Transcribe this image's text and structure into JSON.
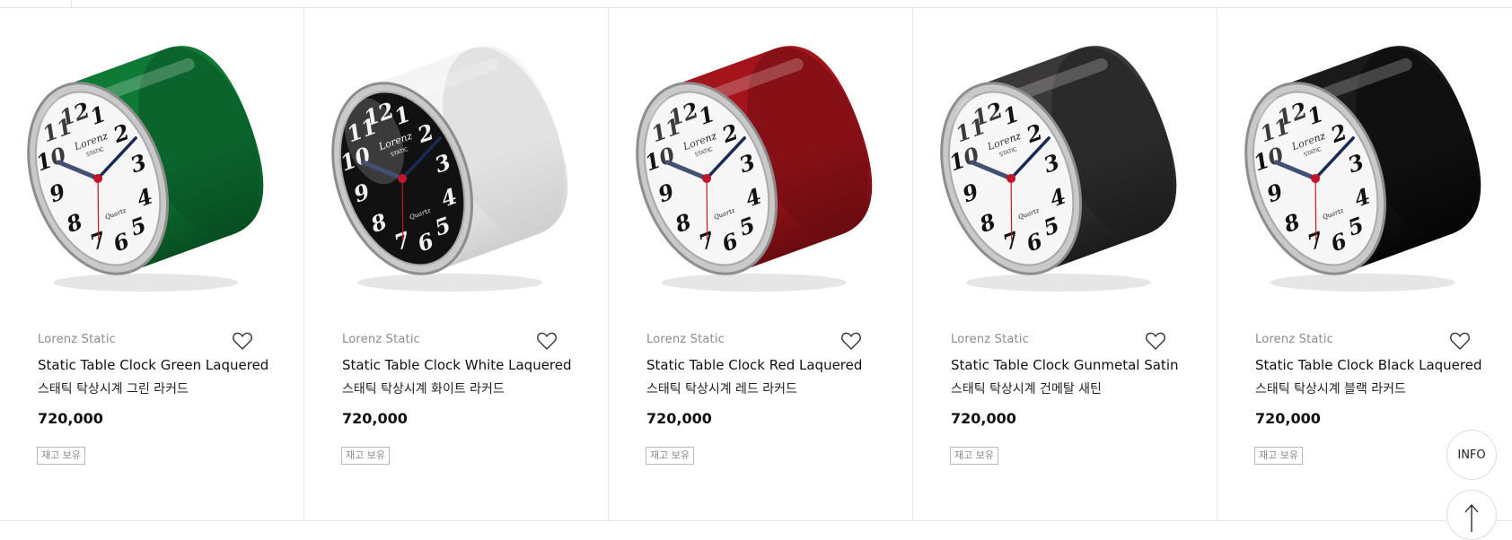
{
  "products": [
    {
      "brand": "Lorenz Static",
      "name_en": "Static Table Clock Green Laquered",
      "name_ko": "스태틱 탁상시계 그린 라커드",
      "price": "720,000",
      "stock_label": "재고 보유",
      "body_color": "#0f7a36",
      "body_shade": "#074e21",
      "face": "white"
    },
    {
      "brand": "Lorenz Static",
      "name_en": "Static Table Clock White Laquered",
      "name_ko": "스태틱 탁상시계 화이트 라커드",
      "price": "720,000",
      "stock_label": "재고 보유",
      "body_color": "#f4f4f4",
      "body_shade": "#cfcfcf",
      "face": "black"
    },
    {
      "brand": "Lorenz Static",
      "name_en": "Static Table Clock Red Laquered",
      "name_ko": "스태틱 탁상시계 레드 라커드",
      "price": "720,000",
      "stock_label": "재고 보유",
      "body_color": "#a3151b",
      "body_shade": "#6a0b10",
      "face": "white"
    },
    {
      "brand": "Lorenz Static",
      "name_en": "Static Table Clock Gunmetal Satin",
      "name_ko": "스태틱 탁상시계 건메탈 새틴",
      "price": "720,000",
      "stock_label": "재고 보유",
      "body_color": "#3a3838",
      "body_shade": "#1c1b1b",
      "face": "white"
    },
    {
      "brand": "Lorenz Static",
      "name_en": "Static Table Clock Black Laquered",
      "name_ko": "스태틱 탁상시계 블랙 라커드",
      "price": "720,000",
      "stock_label": "재고 보유",
      "body_color": "#1a1a1a",
      "body_shade": "#050505",
      "face": "white"
    }
  ],
  "floating": {
    "info_label": "INFO",
    "top_icon": "arrow-up-icon"
  },
  "dial": {
    "brand_text": "Lorenz",
    "model_text": "STATIC",
    "movement_text": "Quartz"
  }
}
